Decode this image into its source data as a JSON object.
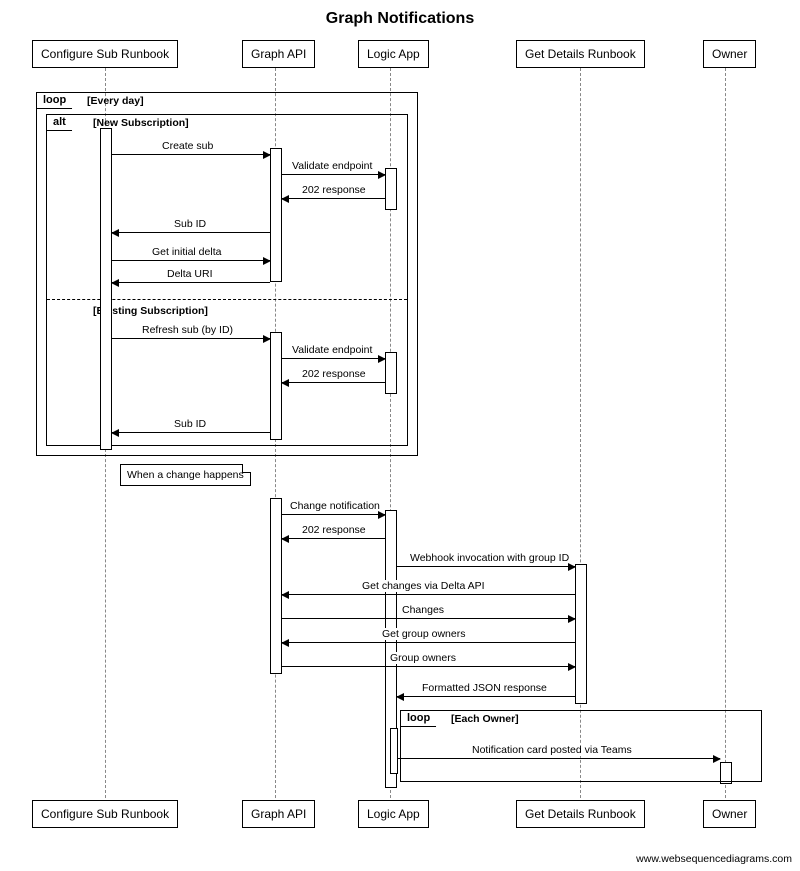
{
  "title": "Graph Notifications",
  "footer": "www.websequencediagrams.com",
  "participants": [
    {
      "id": "cfg",
      "label": "Configure Sub Runbook"
    },
    {
      "id": "gapi",
      "label": "Graph API"
    },
    {
      "id": "logic",
      "label": "Logic App"
    },
    {
      "id": "det",
      "label": "Get Details Runbook"
    },
    {
      "id": "own",
      "label": "Owner"
    }
  ],
  "fragments": {
    "loop_outer": {
      "label": "loop",
      "guard": "[Every day]"
    },
    "alt": {
      "label": "alt",
      "guard_top": "[New Subscription]",
      "guard_bottom": "[Existing Subscription]"
    },
    "loop_owner": {
      "label": "loop",
      "guard": "[Each Owner]"
    }
  },
  "note": "When a change happens",
  "messages": {
    "m1": "Create sub",
    "m2": "Validate endpoint",
    "m3": "202 response",
    "m4": "Sub ID",
    "m5": "Get initial delta",
    "m6": "Delta URI",
    "m7": "Refresh sub (by ID)",
    "m8": "Validate endpoint",
    "m9": "202 response",
    "m10": "Sub ID",
    "m11": "Change notification",
    "m12": "202 response",
    "m13": "Webhook invocation with group ID",
    "m14": "Get changes via Delta API",
    "m15": "Changes",
    "m16": "Get group owners",
    "m17": "Group owners",
    "m18": "Formatted JSON response",
    "m19": "Notification card posted via Teams"
  }
}
